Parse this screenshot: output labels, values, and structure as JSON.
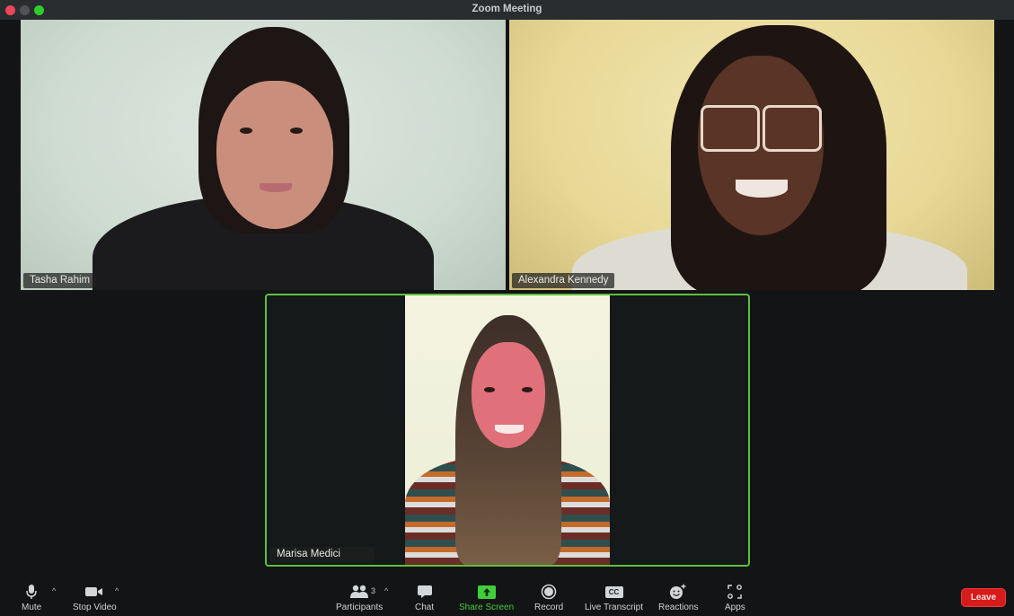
{
  "window": {
    "title": "Zoom Meeting",
    "controls": [
      "close",
      "minimize",
      "maximize"
    ]
  },
  "participants": [
    {
      "name": "Tasha Rahim",
      "active_speaker": false
    },
    {
      "name": "Alexandra Kennedy",
      "active_speaker": false
    },
    {
      "name": "Marisa Medici",
      "active_speaker": true
    }
  ],
  "colors": {
    "active_speaker_border": "#5fbf3a",
    "share_screen": "#3ecf3a",
    "leave": "#d71a1a"
  },
  "toolbar": {
    "mute": {
      "label": "Mute",
      "icon": "microphone-icon"
    },
    "stop_video": {
      "label": "Stop Video",
      "icon": "video-camera-icon"
    },
    "participants": {
      "label": "Participants",
      "count": "3",
      "icon": "people-icon"
    },
    "chat": {
      "label": "Chat",
      "icon": "chat-bubble-icon"
    },
    "share_screen": {
      "label": "Share Screen",
      "icon": "share-arrow-icon"
    },
    "record": {
      "label": "Record",
      "icon": "record-icon"
    },
    "live_transcript": {
      "label": "Live Transcript",
      "icon_text": "CC"
    },
    "reactions": {
      "label": "Reactions",
      "icon": "smiley-plus-icon"
    },
    "apps": {
      "label": "Apps",
      "icon": "apps-icon"
    },
    "leave": {
      "label": "Leave"
    },
    "caret": "^"
  }
}
